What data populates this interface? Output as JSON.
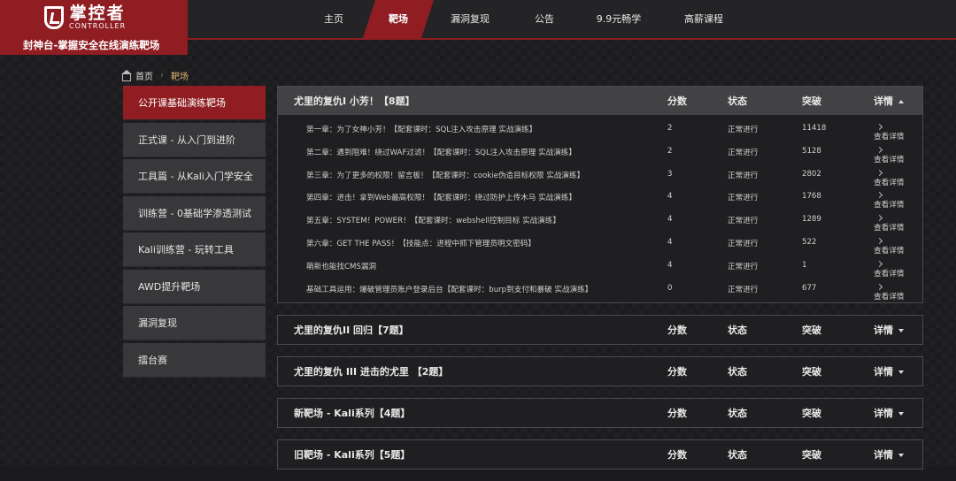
{
  "header": {
    "logo_cn": "掌控者",
    "logo_en": "CONTROLLER",
    "slogan": "封神台-掌握安全在线演练靶场",
    "nav": [
      {
        "label": "主页"
      },
      {
        "label": "靶场"
      },
      {
        "label": "漏洞复现"
      },
      {
        "label": "公告"
      },
      {
        "label": "9.9元畅学"
      },
      {
        "label": "高薪课程"
      }
    ],
    "accent_color": "#8f1d22"
  },
  "breadcrumb": {
    "home": "首页",
    "current": "靶场"
  },
  "sidebar": {
    "items": [
      {
        "label": "公开课基础演练靶场"
      },
      {
        "label": "正式课 - 从入门到进阶"
      },
      {
        "label": "工具篇 - 从Kali入门学安全"
      },
      {
        "label": "训练营 - 0基础学渗透测试"
      },
      {
        "label": "Kali训练营 - 玩转工具"
      },
      {
        "label": "AWD提升靶场"
      },
      {
        "label": "漏洞复现"
      },
      {
        "label": "擂台赛"
      }
    ]
  },
  "columns": {
    "score": "分数",
    "status": "状态",
    "solve": "突破",
    "detail": "详情"
  },
  "panels": [
    {
      "title": "尤里的复仇Ⅰ 小芳！【8题】",
      "rows": [
        {
          "title": "第一章：为了女神小芳！【配套课时：SQL注入攻击原理 实战演练】",
          "score": "2",
          "status": "正常进行",
          "solve": "11418",
          "detail": "查看详情"
        },
        {
          "title": "第二章：遇到阻难！绕过WAF过滤！【配套课时：SQL注入攻击原理 实战演练】",
          "score": "2",
          "status": "正常进行",
          "solve": "5128",
          "detail": "查看详情"
        },
        {
          "title": "第三章：为了更多的权限！留言板！【配套课时：cookie伪造目标权限 实战演练】",
          "score": "3",
          "status": "正常进行",
          "solve": "2802",
          "detail": "查看详情"
        },
        {
          "title": "第四章：进击！拿到Web最高权限！【配套课时：绕过防护上传木马 实战演练】",
          "score": "4",
          "status": "正常进行",
          "solve": "1768",
          "detail": "查看详情"
        },
        {
          "title": "第五章：SYSTEM！POWER！【配套课时：webshell控制目标 实战演练】",
          "score": "4",
          "status": "正常进行",
          "solve": "1289",
          "detail": "查看详情"
        },
        {
          "title": "第六章：GET THE PASS！【技能点：进程中抓下管理员明文密码】",
          "score": "4",
          "status": "正常进行",
          "solve": "522",
          "detail": "查看详情"
        },
        {
          "title": "萌新也能找CMS漏洞",
          "score": "4",
          "status": "正常进行",
          "solve": "1",
          "detail": "查看详情"
        },
        {
          "title": "基础工具运用：爆破管理员账户登录后台【配套课时：burp到支付和暴破 实战演练】",
          "score": "0",
          "status": "正常进行",
          "solve": "677",
          "detail": "查看详情"
        }
      ]
    },
    {
      "title": "尤里的复仇II 回归【7题】"
    },
    {
      "title": "尤里的复仇 III 进击的尤里 【2题】"
    },
    {
      "title": "新靶场 - Kali系列【4题】"
    },
    {
      "title": "旧靶场 - Kali系列【5题】"
    }
  ]
}
